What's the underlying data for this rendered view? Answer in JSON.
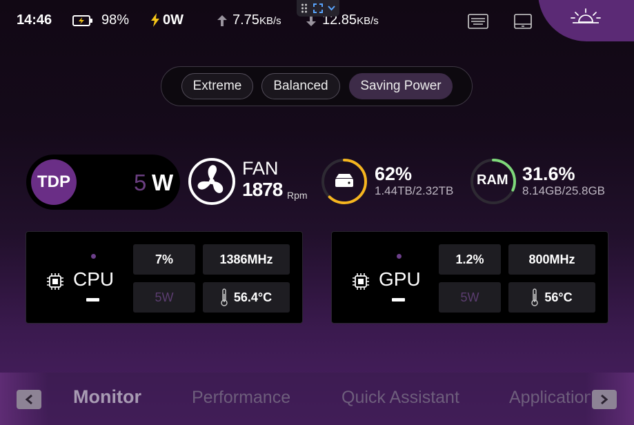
{
  "status_bar": {
    "time": "14:46",
    "battery": "98%",
    "power": "0W",
    "upload_value": "7.75",
    "upload_unit": "KB/s",
    "download_value": "12.85",
    "download_unit": "KB/s"
  },
  "modes": {
    "items": [
      "Extreme",
      "Balanced",
      "Saving Power"
    ],
    "selected": "Saving Power"
  },
  "tdp": {
    "label": "TDP",
    "value": "5",
    "unit": "W"
  },
  "fan": {
    "label": "FAN",
    "rpm": "1878",
    "rpm_unit": "Rpm"
  },
  "disk": {
    "percent": "62%",
    "fraction": 0.62,
    "detail": "1.44TB/2.32TB",
    "ring_color": "#f5b51f"
  },
  "ram": {
    "label": "RAM",
    "percent": "31.6%",
    "fraction": 0.316,
    "detail": "8.14GB/25.8GB",
    "ring_color": "#7ed87a"
  },
  "cpu": {
    "title": "CPU",
    "load": "7%",
    "frequency": "1386MHz",
    "power": "5W",
    "temperature": "56.4°C"
  },
  "gpu": {
    "title": "GPU",
    "load": "1.2%",
    "frequency": "800MHz",
    "power": "5W",
    "temperature": "56°C"
  },
  "nav": {
    "tabs": [
      "Monitor",
      "Performance",
      "Quick Assistant",
      "Application"
    ],
    "active": "Monitor"
  },
  "colors": {
    "accent": "#6a2e86",
    "brightness_tab": "#5b2a75",
    "selected_mode": "#3d2b48"
  },
  "icons": {
    "battery": "battery-charging-icon",
    "power": "lightning-icon",
    "upload": "arrow-up-icon",
    "download": "arrow-down-icon",
    "keyboard": "keyboard-icon",
    "screen": "tablet-screen-icon",
    "brightness": "sun-brightness-icon",
    "fan": "fan-icon",
    "disk": "hard-drive-icon",
    "chip": "chip-icon",
    "thermometer": "thermometer-icon"
  }
}
